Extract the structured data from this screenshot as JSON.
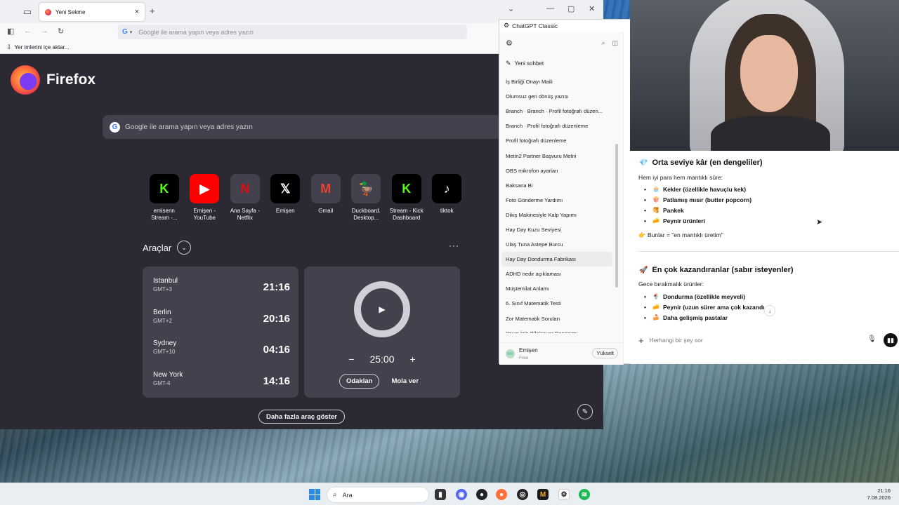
{
  "firefox": {
    "tab_title": "Yeni Sekme",
    "url_placeholder": "Google ile arama yapın veya adres yazın",
    "bookmarks_import": "Yer imlerini içe aktar...",
    "brand": "Firefox",
    "search_placeholder": "Google ile arama yapın veya adres yazın",
    "shortcuts": [
      {
        "label": "emisenn Stream -...",
        "glyph": "K",
        "bg": "#000000",
        "fg": "#53fc18"
      },
      {
        "label": "Emişen - YouTube",
        "glyph": "▶",
        "bg": "#ff0000",
        "fg": "#ffffff"
      },
      {
        "label": "Ana Sayfa - Netflix",
        "glyph": "N",
        "bg": "#42414d",
        "fg": "#e50914"
      },
      {
        "label": "Emişen",
        "glyph": "𝕏",
        "bg": "#000000",
        "fg": "#ffffff"
      },
      {
        "label": "Gmail",
        "glyph": "M",
        "bg": "#42414d",
        "fg": "#ea4335"
      },
      {
        "label": "Duckboard. Desktop...",
        "glyph": "🦆",
        "bg": "#42414d",
        "fg": "#ffd400"
      },
      {
        "label": "Stream - Kick Dashboard",
        "glyph": "K",
        "bg": "#000000",
        "fg": "#53fc18"
      },
      {
        "label": "tiktok",
        "glyph": "♪",
        "bg": "#000000",
        "fg": "#ffffff"
      }
    ],
    "tools_title": "Araçlar",
    "clocks": [
      {
        "city": "Istanbul",
        "tz": "GMT+3",
        "time": "21:16"
      },
      {
        "city": "Berlin",
        "tz": "GMT+2",
        "time": "20:16"
      },
      {
        "city": "Sydney",
        "tz": "GMT+10",
        "time": "04:16"
      },
      {
        "city": "New York",
        "tz": "GMT-4",
        "time": "14:16"
      }
    ],
    "timer": {
      "value": "25:00",
      "focus_label": "Odaklan",
      "break_label": "Mola ver"
    },
    "more_tools": "Daha fazla araç göster"
  },
  "gpt": {
    "window_title": "ChatGPT Classic",
    "new_chat": "Yeni sohbet",
    "history": [
      "İş Birliği Onayı Maili",
      "Olumsuz geri dönüş yazısı",
      "Branch · Branch · Profil fotoğrafı düzen...",
      "Branch · Profil fotoğrafı düzenleme",
      "Profil fotoğrafı düzenleme",
      "Metin2 Partner Başvuru Metni",
      "OBS mikrofon ayarları",
      "Baksana Bi",
      "Foto Gönderme Yardımı",
      "Dikiş Makinesiyle Kalp Yapımı",
      "Hay Day Kuzu Seviyesi",
      "Ulaş Tuna Astepe Burcu",
      "Hay Day Dondurma Fabrikası",
      "ADHD nedir açıklaması",
      "Müştemilat Anlamı",
      "6. Sınıf Matematik Testi",
      "Zor Matematik Soruları",
      "Yayın İçin Bilgisayar Donanımı"
    ],
    "selected_index": 12,
    "user_initials": "EM",
    "user_name": "Emişen",
    "user_plan": "Free",
    "upgrade": "Yükselt",
    "section1_title": "Orta seviye kâr (en dengeliler)",
    "section1_intro": "Hem iyi para hem mantıklı süre:",
    "section1_items": [
      {
        "emoji": "🧁",
        "text": "Kekler (özellikle havuçlu kek)"
      },
      {
        "emoji": "🍿",
        "text": "Patlamış mısır (butter popcorn)"
      },
      {
        "emoji": "🥞",
        "text": "Pankek"
      },
      {
        "emoji": "🧀",
        "text": "Peynir ürünleri"
      }
    ],
    "section1_note": "Bunlar = \"en mantıklı üretim\"",
    "section2_title": "En çok kazandıranlar (sabır isteyenler)",
    "section2_intro": "Gece bırakmalık ürünler:",
    "section2_items": [
      {
        "emoji": "🍨",
        "text": "Dondurma (özellikle meyveli)"
      },
      {
        "emoji": "🧀",
        "text": "Peynir (uzun sürer ama çok kazandı...)"
      },
      {
        "emoji": "🍰",
        "text": "Daha gelişmiş pastalar"
      }
    ],
    "composer_placeholder": "Herhangi bir şey sor"
  },
  "taskbar": {
    "search": "Ara",
    "time": "21:16",
    "date": "7.08.2026"
  }
}
